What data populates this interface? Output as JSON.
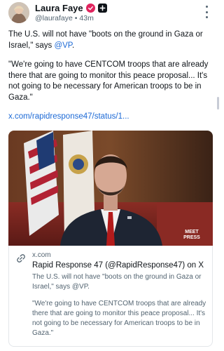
{
  "author": {
    "name": "Laura Faye",
    "handle": "@laurafaye",
    "separator": "•",
    "time": "43m",
    "avatar": "avatar-photo",
    "verified_color": "#e0245e"
  },
  "icons": {
    "verified": "verified-badge-icon",
    "plus": "plus-badge-icon",
    "more": "more-vertical-icon",
    "link": "link-icon"
  },
  "post": {
    "p1_prefix": "The U.S. will not have \"boots on the ground in Gaza or Israel,\" says ",
    "p1_mention": "@VP",
    "p1_suffix": ".",
    "p2": "\"We're going to have CENTCOM troops that are already there that are going to monitor this peace proposal... It's not going to be necessary for American troops to be in Gaza.\"",
    "link": "x.com/rapidresponse47/status/1..."
  },
  "media": {
    "watermark_line1": "MEET",
    "watermark_line2": "PRESS"
  },
  "card": {
    "domain": "x.com",
    "title": "Rapid Response 47 (@RapidResponse47) on X",
    "desc1": "The U.S. will not have \"boots on the ground in Gaza or Israel,\" says @VP.",
    "desc2": "\"We're going to have CENTCOM troops that are already there that are going to monitor this peace proposal... It's not going to be necessary for American troops to be in Gaza.\""
  },
  "colors": {
    "link": "#1d6ad6",
    "text": "#0f1419",
    "secondary": "#536471"
  }
}
